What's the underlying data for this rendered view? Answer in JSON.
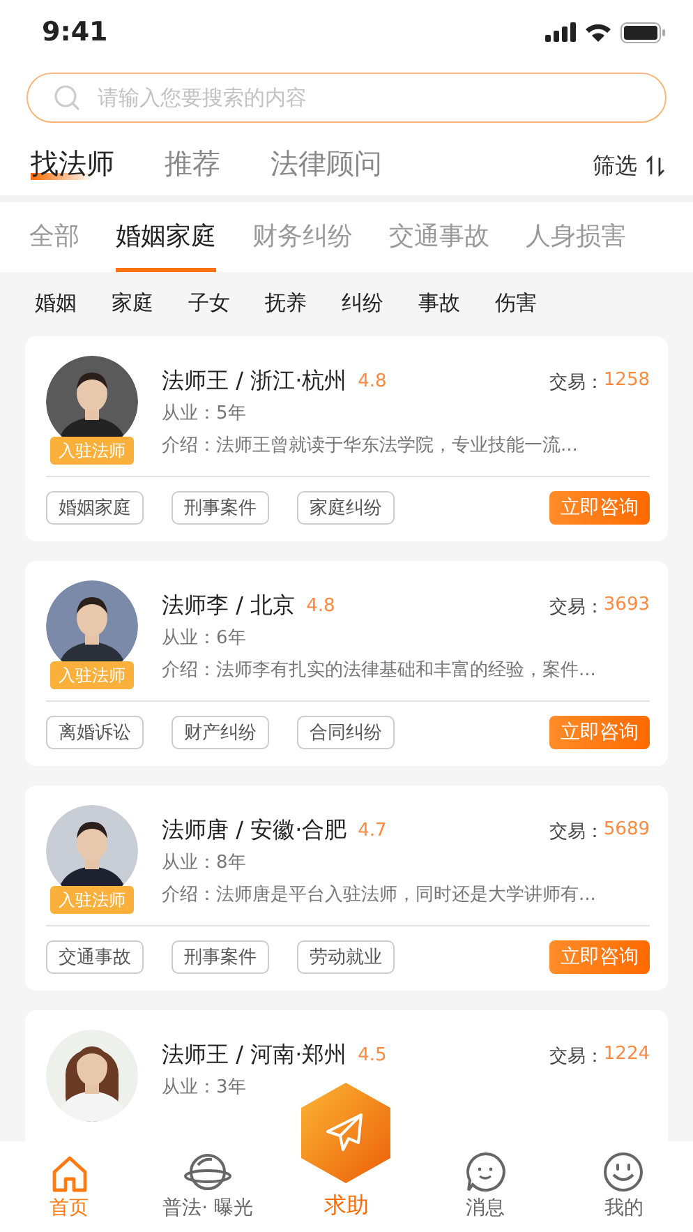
{
  "status_bar": {
    "time": "9:41"
  },
  "search": {
    "placeholder": "请输入您要搜索的内容"
  },
  "main_tabs": [
    {
      "label": "找法师",
      "selected": true
    },
    {
      "label": "推荐",
      "selected": false
    },
    {
      "label": "法律顾问",
      "selected": false
    }
  ],
  "filter": {
    "label": "筛选"
  },
  "categories": [
    {
      "label": "全部",
      "selected": false
    },
    {
      "label": "婚姻家庭",
      "selected": true
    },
    {
      "label": "财务纠纷",
      "selected": false
    },
    {
      "label": "交通事故",
      "selected": false
    },
    {
      "label": "人身损害",
      "selected": false
    }
  ],
  "subtags": [
    "婚姻",
    "家庭",
    "子女",
    "抚养",
    "纠纷",
    "事故",
    "伤害"
  ],
  "lawyers": [
    {
      "title": "法师王 / 浙江·杭州",
      "rating": "4.8",
      "trades_label": "交易：",
      "trades": "1258",
      "badge": "入驻法师",
      "experience": "从业：5年",
      "intro": "介绍：法师王曾就读于华东法学院，专业技能一流...",
      "tags": [
        "婚姻家庭",
        "刑事案件",
        "家庭纠纷"
      ],
      "action": "立即咨询"
    },
    {
      "title": "法师李 / 北京",
      "rating": "4.8",
      "trades_label": "交易：",
      "trades": "3693",
      "badge": "入驻法师",
      "experience": "从业：6年",
      "intro": "介绍：法师李有扎实的法律基础和丰富的经验，案件...",
      "tags": [
        "离婚诉讼",
        "财产纠纷",
        "合同纠纷"
      ],
      "action": "立即咨询"
    },
    {
      "title": "法师唐 / 安徽·合肥",
      "rating": "4.7",
      "trades_label": "交易：",
      "trades": "5689",
      "badge": "入驻法师",
      "experience": "从业：8年",
      "intro": "介绍：法师唐是平台入驻法师，同时还是大学讲师有...",
      "tags": [
        "交通事故",
        "刑事案件",
        "劳动就业"
      ],
      "action": "立即咨询"
    },
    {
      "title": "法师王 / 河南·郑州",
      "rating": "4.5",
      "trades_label": "交易：",
      "trades": "1224",
      "experience": "从业：3年"
    }
  ],
  "nav": [
    {
      "kind": "home",
      "label": "首页",
      "selected": true
    },
    {
      "kind": "planet",
      "label": "普法· 曝光",
      "selected": false
    },
    {
      "kind": "help",
      "label": "求助",
      "selected": false
    },
    {
      "kind": "message",
      "label": "消息",
      "selected": false
    },
    {
      "kind": "profile",
      "label": "我的",
      "selected": false
    }
  ]
}
